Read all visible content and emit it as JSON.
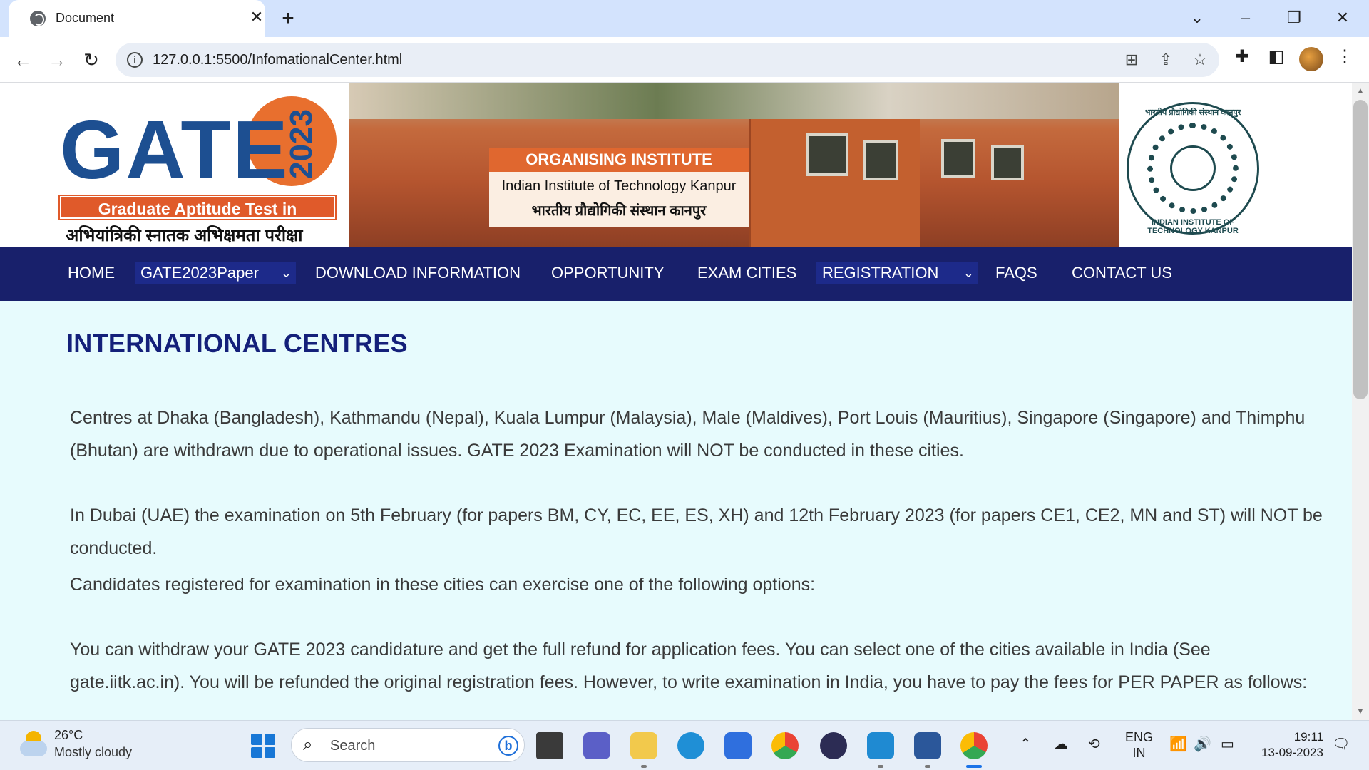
{
  "browser": {
    "tab_title": "Document",
    "url": "127.0.0.1:5500/InfomationalCenter.html"
  },
  "banner": {
    "gate_word": "GATE",
    "gate_year": "2023",
    "gate_subtitle": "Graduate Aptitude Test in Engineering",
    "gate_hindi": "अभियांत्रिकी स्नातक अभिक्षमता परीक्षा",
    "org_heading": "ORGANISING INSTITUTE",
    "org_name_en": "Indian Institute of Technology Kanpur",
    "org_name_hi": "भारतीय प्रौद्योगिकी संस्थान कानपुर",
    "seal_top": "भारतीय प्रौद्योगिकी संस्थान कानपुर",
    "seal_bottom": "INDIAN INSTITUTE OF TECHNOLOGY KANPUR"
  },
  "nav": {
    "home": "HOME",
    "paper_select": "GATE2023Paper",
    "download": "DOWNLOAD INFORMATION",
    "opportunity": "OPPORTUNITY",
    "exam_cities": "EXAM CITIES",
    "registration_select": "REGISTRATION",
    "faqs": "FAQS",
    "contact": "CONTACT US"
  },
  "content": {
    "title": "INTERNATIONAL CENTRES",
    "p1_line1": "Centres at Dhaka (Bangladesh), Kathmandu (Nepal), Kuala Lumpur (Malaysia), Male (Maldives), Port Louis (Mauritius), Singapore (Singapore) and Thimphu",
    "p1_line2": "(Bhutan) are withdrawn due to operational issues. GATE 2023 Examination will NOT be conducted in these cities.",
    "p2_line1": "In Dubai (UAE) the examination on 5th February (for papers BM, CY, EC, EE, ES, XH) and 12th February 2023 (for papers CE1, CE2, MN and ST) will NOT be",
    "p2_line2": "conducted.",
    "p3": "Candidates registered for examination in these cities can exercise one of the following options:",
    "p4_line1": "You can withdraw your GATE 2023 candidature and get the full refund for application fees. You can select one of the cities available in India (See",
    "p4_line2": "gate.iitk.ac.in). You will be refunded the original registration fees. However, to write examination in India, you have to pay the fees for PER PAPER as follows:"
  },
  "taskbar": {
    "temperature": "26°C",
    "weather": "Mostly cloudy",
    "search_placeholder": "Search",
    "lang_1": "ENG",
    "lang_2": "IN",
    "time": "19:11",
    "date": "13-09-2023"
  },
  "colors": {
    "nav_bg": "#18206b",
    "page_bg": "#e7fbfd",
    "title": "#14207a",
    "gate_blue": "#1d4f91",
    "gate_orange": "#e86f2e"
  }
}
